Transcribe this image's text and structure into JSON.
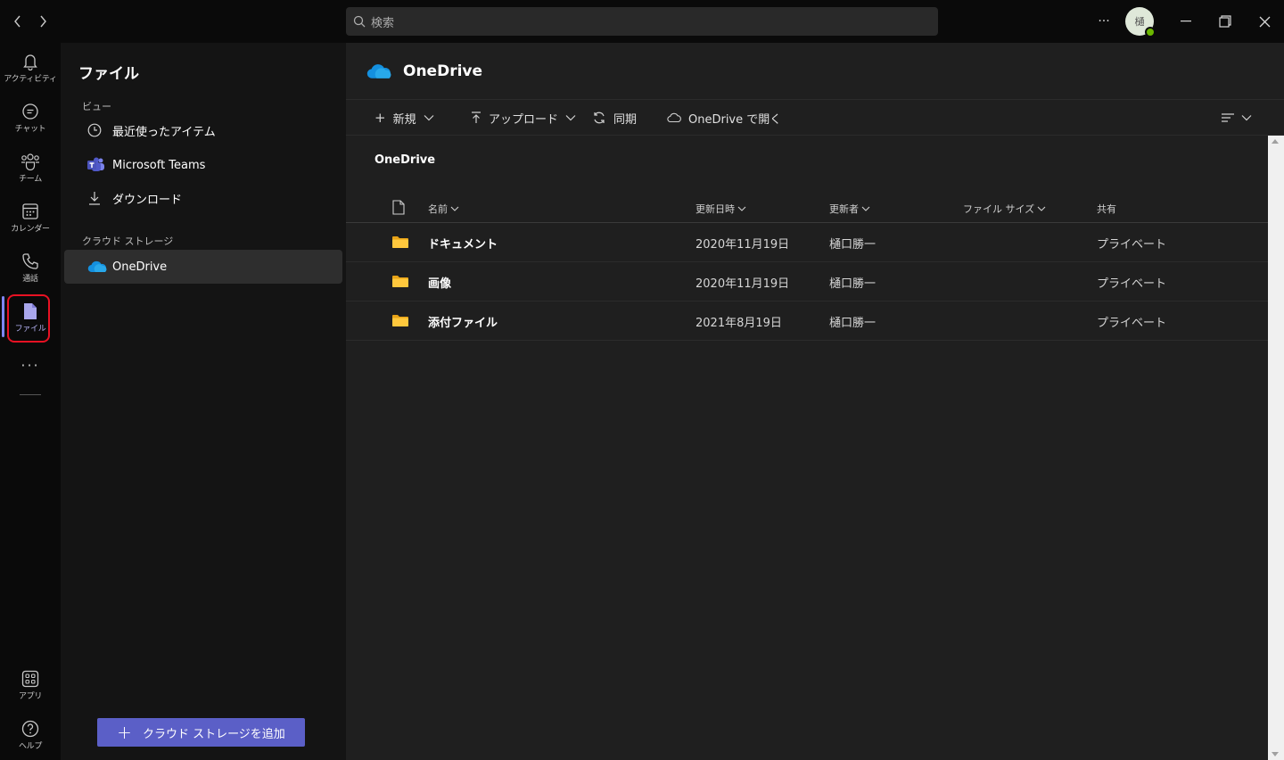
{
  "titlebar": {
    "search_placeholder": "検索",
    "more_label": "···",
    "avatar_initial": "樋"
  },
  "rail": {
    "items": [
      {
        "label": "アクティビティ",
        "icon": "bell-icon"
      },
      {
        "label": "チャット",
        "icon": "chat-icon"
      },
      {
        "label": "チーム",
        "icon": "teams-icon"
      },
      {
        "label": "カレンダー",
        "icon": "calendar-icon"
      },
      {
        "label": "通話",
        "icon": "phone-icon"
      },
      {
        "label": "ファイル",
        "icon": "file-icon",
        "active": true
      },
      {
        "label": "アプリ",
        "icon": "apps-icon"
      },
      {
        "label": "ヘルプ",
        "icon": "help-icon"
      }
    ],
    "more": "···"
  },
  "panel": {
    "title": "ファイル",
    "views_label": "ビュー",
    "views": [
      {
        "label": "最近使ったアイテム",
        "icon": "clock-icon"
      },
      {
        "label": "Microsoft Teams",
        "icon": "teams-logo-icon"
      },
      {
        "label": "ダウンロード",
        "icon": "download-icon"
      }
    ],
    "cloud_label": "クラウド ストレージ",
    "cloud_items": [
      {
        "label": "OneDrive",
        "icon": "onedrive-icon",
        "selected": true
      }
    ],
    "add_storage_label": "クラウド ストレージを追加"
  },
  "main": {
    "title": "OneDrive",
    "toolbar": {
      "new_label": "新規",
      "upload_label": "アップロード",
      "sync_label": "同期",
      "open_label": "OneDrive で開く"
    },
    "breadcrumb": "OneDrive",
    "columns": {
      "name": "名前",
      "modified": "更新日時",
      "modified_by": "更新者",
      "size": "ファイル サイズ",
      "sharing": "共有"
    },
    "rows": [
      {
        "name": "ドキュメント",
        "modified": "2020年11月19日",
        "modified_by": "樋口勝一",
        "size": "",
        "sharing": "プライベート"
      },
      {
        "name": "画像",
        "modified": "2020年11月19日",
        "modified_by": "樋口勝一",
        "size": "",
        "sharing": "プライベート"
      },
      {
        "name": "添付ファイル",
        "modified": "2021年8月19日",
        "modified_by": "樋口勝一",
        "size": "",
        "sharing": "プライベート"
      }
    ]
  },
  "colors": {
    "accent": "#5b5fc7",
    "highlight": "#e81123",
    "folder": "#ffc83d",
    "onedrive": "#1490df"
  }
}
